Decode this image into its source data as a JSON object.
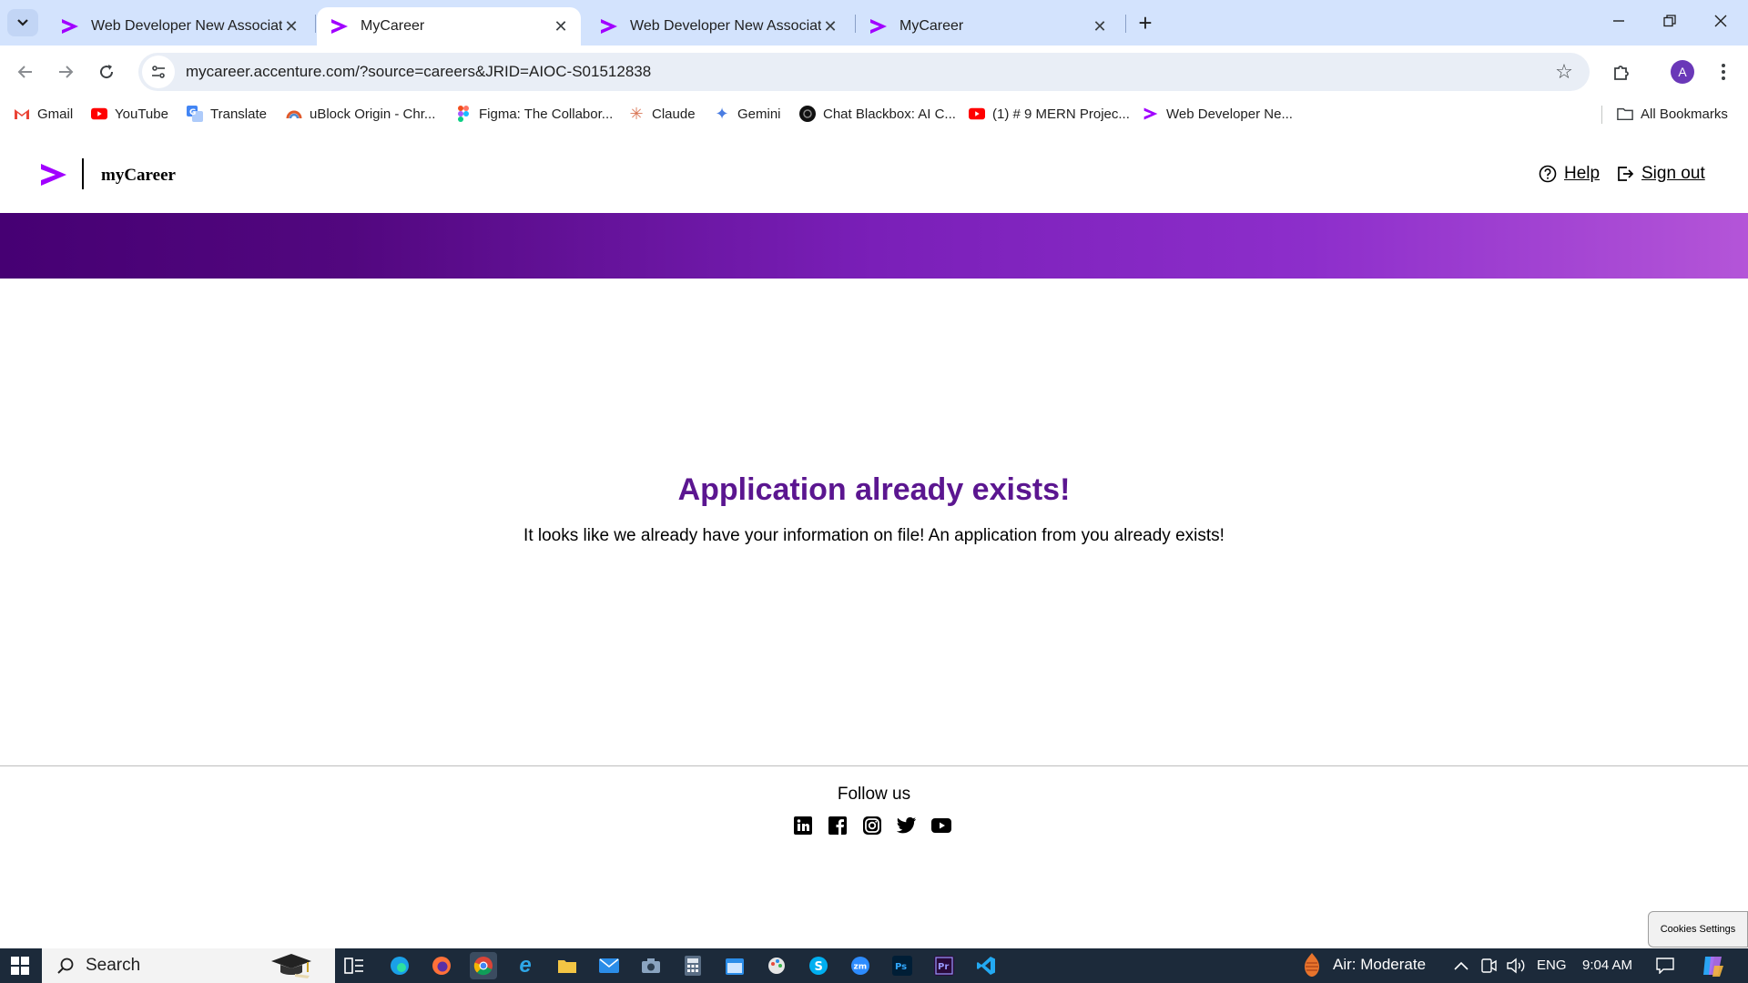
{
  "browser": {
    "tabs": [
      {
        "title": "Web Developer New Associate",
        "active": false
      },
      {
        "title": "MyCareer",
        "active": true
      },
      {
        "title": "Web Developer New Associate",
        "active": false
      },
      {
        "title": "MyCareer",
        "active": false
      }
    ],
    "url": "mycareer.accenture.com/?source=careers&JRID=AIOC-S01512838",
    "profile_initial": "A",
    "bookmarks": [
      {
        "label": "Gmail",
        "icon": "gmail-icon"
      },
      {
        "label": "YouTube",
        "icon": "youtube-icon"
      },
      {
        "label": "Translate",
        "icon": "translate-icon"
      },
      {
        "label": "uBlock Origin - Chr...",
        "icon": "ublock-icon"
      },
      {
        "label": "Figma: The Collabor...",
        "icon": "figma-icon"
      },
      {
        "label": "Claude",
        "icon": "claude-icon"
      },
      {
        "label": "Gemini",
        "icon": "gemini-icon"
      },
      {
        "label": "Chat Blackbox: AI C...",
        "icon": "blackbox-icon"
      },
      {
        "label": "(1) # 9 MERN Projec...",
        "icon": "youtube-icon"
      },
      {
        "label": "Web Developer Ne...",
        "icon": "accenture-icon"
      }
    ],
    "all_bookmarks": "All Bookmarks"
  },
  "site": {
    "brand": "myCareer",
    "help": "Help",
    "signout": "Sign out",
    "brand_color": "#a100ff",
    "banner_colors": [
      "#460073",
      "#b455d8"
    ]
  },
  "message": {
    "title": "Application already exists!",
    "body": "It looks like we already have your information on file! An application from you already exists!",
    "title_color": "#5b1690"
  },
  "footer": {
    "follow": "Follow us",
    "social": [
      "linkedin-icon",
      "facebook-icon",
      "instagram-icon",
      "twitter-icon",
      "youtube-icon"
    ],
    "cookies": "Cookies Settings"
  },
  "taskbar": {
    "search": "Search",
    "air": "Air: Moderate",
    "lang": "ENG",
    "time": "9:04 AM"
  }
}
